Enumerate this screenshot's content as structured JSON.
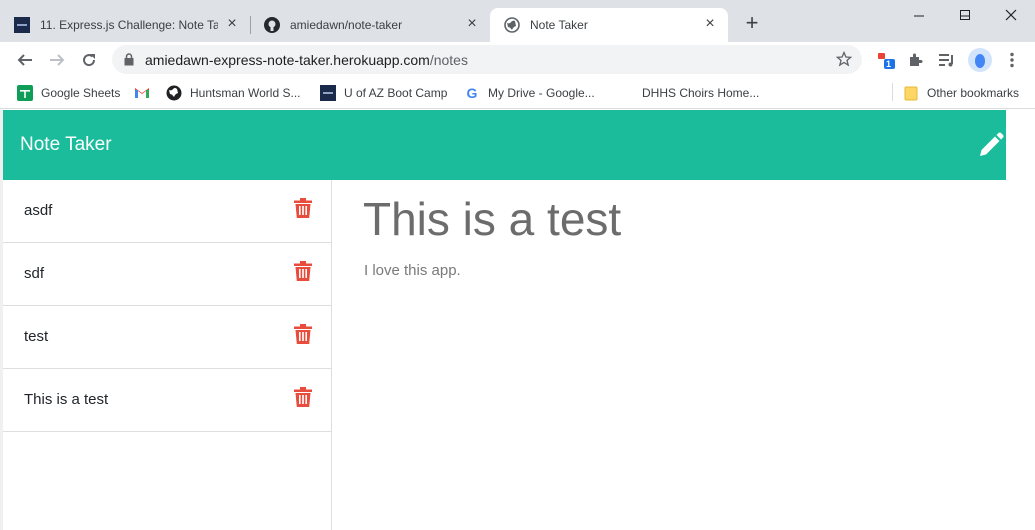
{
  "browser": {
    "tabs": [
      {
        "title": "11. Express.js Challenge: Note Tak",
        "icon": "bootcamp-favicon",
        "active": false
      },
      {
        "title": "amiedawn/note-taker",
        "icon": "github-icon",
        "active": false
      },
      {
        "title": "Note Taker",
        "icon": "globe-icon",
        "active": true
      }
    ],
    "address": {
      "host": "amiedawn-express-note-taker.herokuapp.com",
      "path": "/notes"
    },
    "extension_badge": "1",
    "bookmarks": [
      {
        "label": "Google Sheets",
        "icon": "sheets-icon"
      },
      {
        "label": "",
        "icon": "gmail-icon"
      },
      {
        "label": "Huntsman World S...",
        "icon": "world-icon"
      },
      {
        "label": "U of AZ Boot Camp",
        "icon": "bootcamp-favicon"
      },
      {
        "label": "My Drive - Google...",
        "icon": "google-icon"
      },
      {
        "label": "DHHS Choirs Home...",
        "icon": ""
      },
      {
        "label": "Other bookmarks",
        "icon": "folder-icon"
      }
    ]
  },
  "app": {
    "brand": "Note Taker",
    "accent": "#1abc9c",
    "delete_color": "#e74c3c",
    "notes": [
      {
        "title": "asdf"
      },
      {
        "title": "sdf"
      },
      {
        "title": "test"
      },
      {
        "title": "This is a test"
      }
    ],
    "active_note": {
      "title": "This is a test",
      "text": "I love this app."
    }
  }
}
